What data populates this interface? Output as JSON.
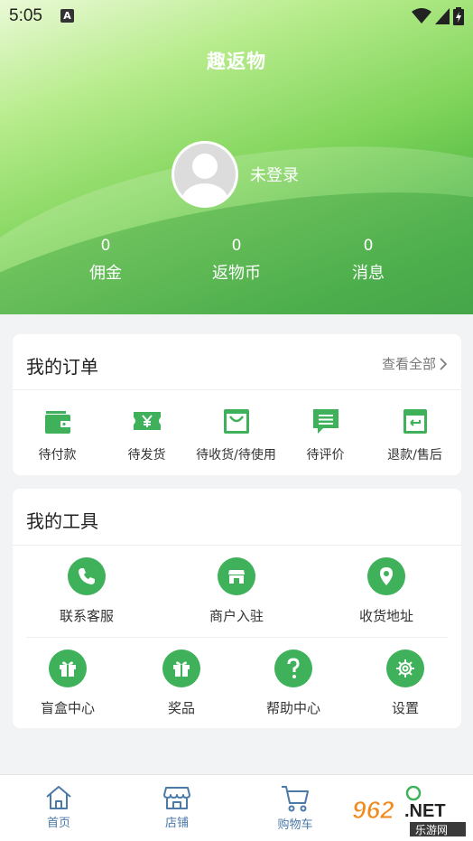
{
  "status_bar": {
    "time": "5:05",
    "notification_badge": "A"
  },
  "header": {
    "app_title": "趣返物",
    "login_status": "未登录",
    "stats": [
      {
        "value": "0",
        "label": "佣金"
      },
      {
        "value": "0",
        "label": "返物币"
      },
      {
        "value": "0",
        "label": "消息"
      }
    ]
  },
  "orders": {
    "title": "我的订单",
    "view_all": "查看全部",
    "items": [
      {
        "label": "待付款",
        "icon": "wallet-icon"
      },
      {
        "label": "待发货",
        "icon": "ticket-yen-icon"
      },
      {
        "label": "待收货/待使用",
        "icon": "bag-icon"
      },
      {
        "label": "待评价",
        "icon": "comment-icon"
      },
      {
        "label": "退款/售后",
        "icon": "refund-icon"
      }
    ]
  },
  "tools": {
    "title": "我的工具",
    "row1": [
      {
        "label": "联系客服",
        "icon": "phone-icon"
      },
      {
        "label": "商户入驻",
        "icon": "shop-icon"
      },
      {
        "label": "收货地址",
        "icon": "location-icon"
      }
    ],
    "row2": [
      {
        "label": "盲盒中心",
        "icon": "gift-icon"
      },
      {
        "label": "奖品",
        "icon": "prize-gift-icon"
      },
      {
        "label": "帮助中心",
        "icon": "question-icon"
      },
      {
        "label": "设置",
        "icon": "gear-icon"
      }
    ]
  },
  "bottom_nav": [
    {
      "label": "首页",
      "icon": "home-icon"
    },
    {
      "label": "店铺",
      "icon": "store-icon"
    },
    {
      "label": "购物车",
      "icon": "cart-icon"
    }
  ],
  "watermark": {
    "brand": "962.NET",
    "sub": "乐游网"
  },
  "colors": {
    "accent": "#3fb15a",
    "nav_text": "#4b79a8"
  }
}
